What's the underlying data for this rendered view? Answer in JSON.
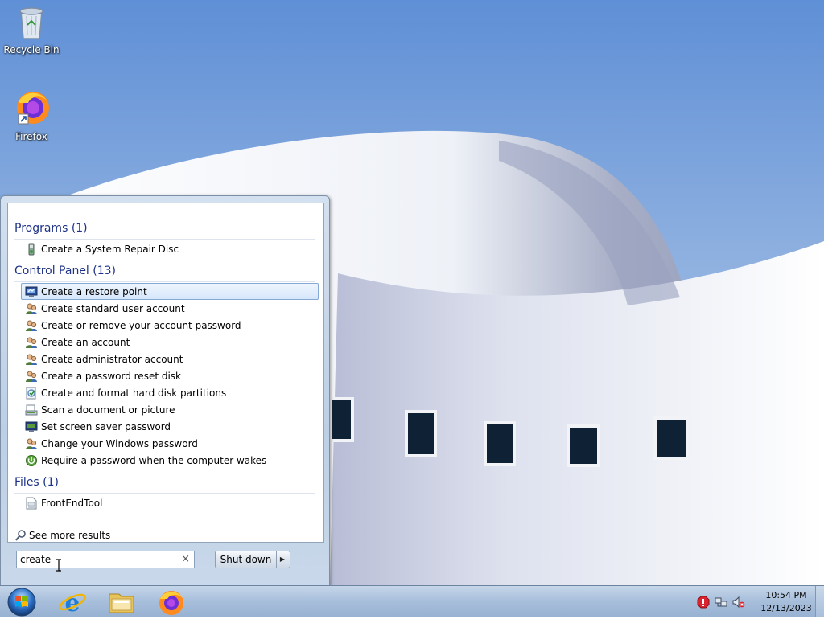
{
  "desktop": {
    "icons": [
      {
        "label": "Recycle Bin",
        "icon": "recycle-bin-icon"
      },
      {
        "label": "Firefox",
        "icon": "firefox-icon"
      }
    ]
  },
  "start_menu": {
    "groups": {
      "programs": {
        "heading": "Programs (1)",
        "items": [
          {
            "label": "Create a System Repair Disc",
            "icon": "repair-disc-icon"
          }
        ]
      },
      "control_panel": {
        "heading": "Control Panel (13)",
        "items": [
          {
            "label": "Create a restore point",
            "icon": "system-icon",
            "selected": true
          },
          {
            "label": "Create standard user account",
            "icon": "user-accounts-icon"
          },
          {
            "label": "Create or remove your account password",
            "icon": "user-accounts-icon"
          },
          {
            "label": "Create an account",
            "icon": "user-accounts-icon"
          },
          {
            "label": "Create administrator account",
            "icon": "user-accounts-icon"
          },
          {
            "label": "Create a password reset disk",
            "icon": "user-accounts-icon"
          },
          {
            "label": "Create and format hard disk partitions",
            "icon": "admin-tools-icon"
          },
          {
            "label": "Scan a document or picture",
            "icon": "scanner-icon"
          },
          {
            "label": "Set screen saver password",
            "icon": "display-icon"
          },
          {
            "label": "Change your Windows password",
            "icon": "user-accounts-icon"
          },
          {
            "label": "Require a password when the computer wakes",
            "icon": "power-options-icon"
          }
        ]
      },
      "files": {
        "heading": "Files (1)",
        "items": [
          {
            "label": "FrontEndTool",
            "icon": "file-icon"
          }
        ]
      }
    },
    "see_more": "See more results",
    "search": {
      "value": "create",
      "clear_glyph": "×"
    },
    "shutdown": {
      "label": "Shut down",
      "arrow_glyph": "▶"
    }
  },
  "taskbar": {
    "pinned": [
      {
        "name": "internet-explorer",
        "icon": "internet-explorer-icon"
      },
      {
        "name": "windows-explorer",
        "icon": "folder-icon"
      },
      {
        "name": "firefox",
        "icon": "firefox-icon"
      }
    ],
    "tray": {
      "icons": [
        "action-center-alert-icon",
        "network-icon",
        "volume-muted-icon"
      ],
      "time": "10:54 PM",
      "date": "12/13/2023"
    }
  },
  "colors": {
    "group_heading": "#1e3287",
    "selection_border": "#86a8d4",
    "taskbar": "#a9c0dc",
    "sky": "#8fb1e0"
  }
}
